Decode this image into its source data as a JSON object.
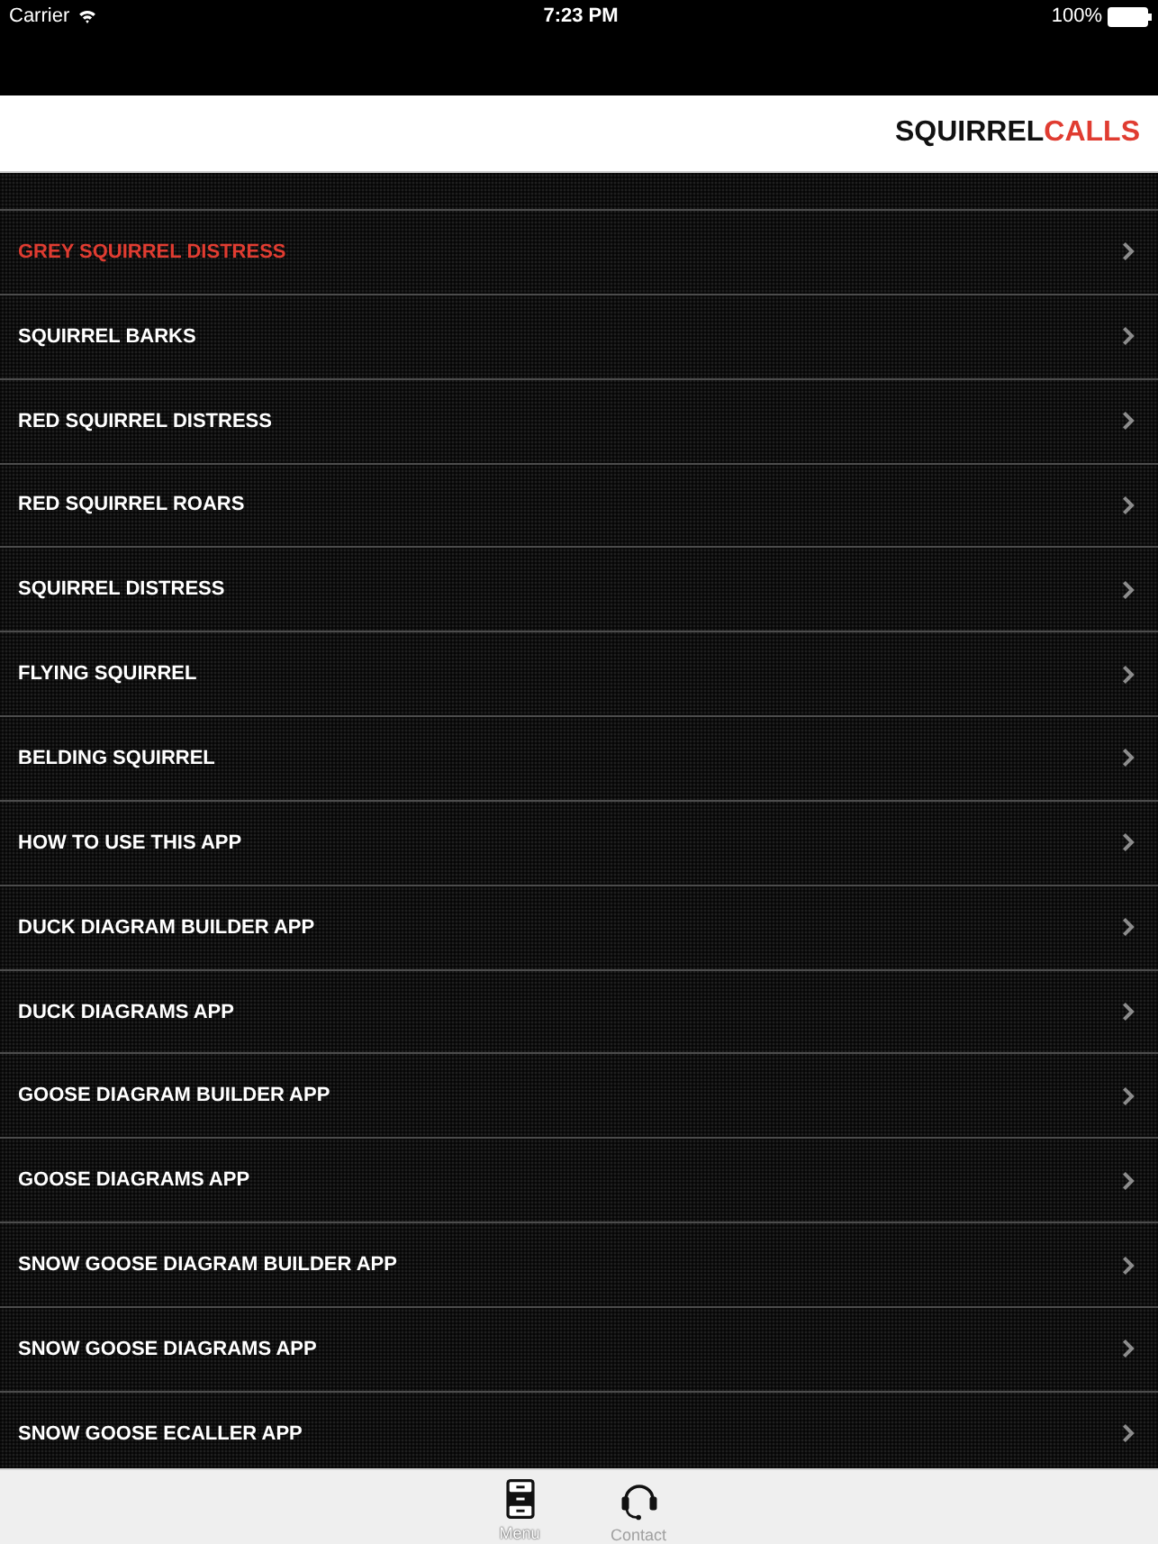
{
  "status_bar": {
    "carrier": "Carrier",
    "time": "7:23 PM",
    "battery": "100%"
  },
  "header": {
    "title": "SQUIRREL",
    "title_accent": "CALLS"
  },
  "menu": [
    {
      "label": "GREY SQUIRREL DISTRESS",
      "selected": true
    },
    {
      "label": "SQUIRREL BARKS",
      "selected": false
    },
    {
      "label": "RED SQUIRREL DISTRESS",
      "selected": false
    },
    {
      "label": "RED SQUIRREL ROARS",
      "selected": false
    },
    {
      "label": "SQUIRREL DISTRESS",
      "selected": false
    },
    {
      "label": "FLYING SQUIRREL",
      "selected": false
    },
    {
      "label": "BELDING SQUIRREL",
      "selected": false
    },
    {
      "label": "HOW TO USE THIS APP",
      "selected": false
    },
    {
      "label": "DUCK DIAGRAM BUILDER APP",
      "selected": false
    },
    {
      "label": "DUCK DIAGRAMS APP",
      "selected": false
    },
    {
      "label": "GOOSE DIAGRAM BUILDER APP",
      "selected": false
    },
    {
      "label": "GOOSE DIAGRAMS APP",
      "selected": false
    },
    {
      "label": "SNOW GOOSE DIAGRAM BUILDER APP",
      "selected": false
    },
    {
      "label": "SNOW GOOSE DIAGRAMS APP",
      "selected": false
    },
    {
      "label": "SNOW GOOSE ECALLER APP",
      "selected": false
    }
  ],
  "tab_bar": [
    {
      "label": "Menu",
      "selected": true
    },
    {
      "label": "Contact",
      "selected": false
    }
  ]
}
